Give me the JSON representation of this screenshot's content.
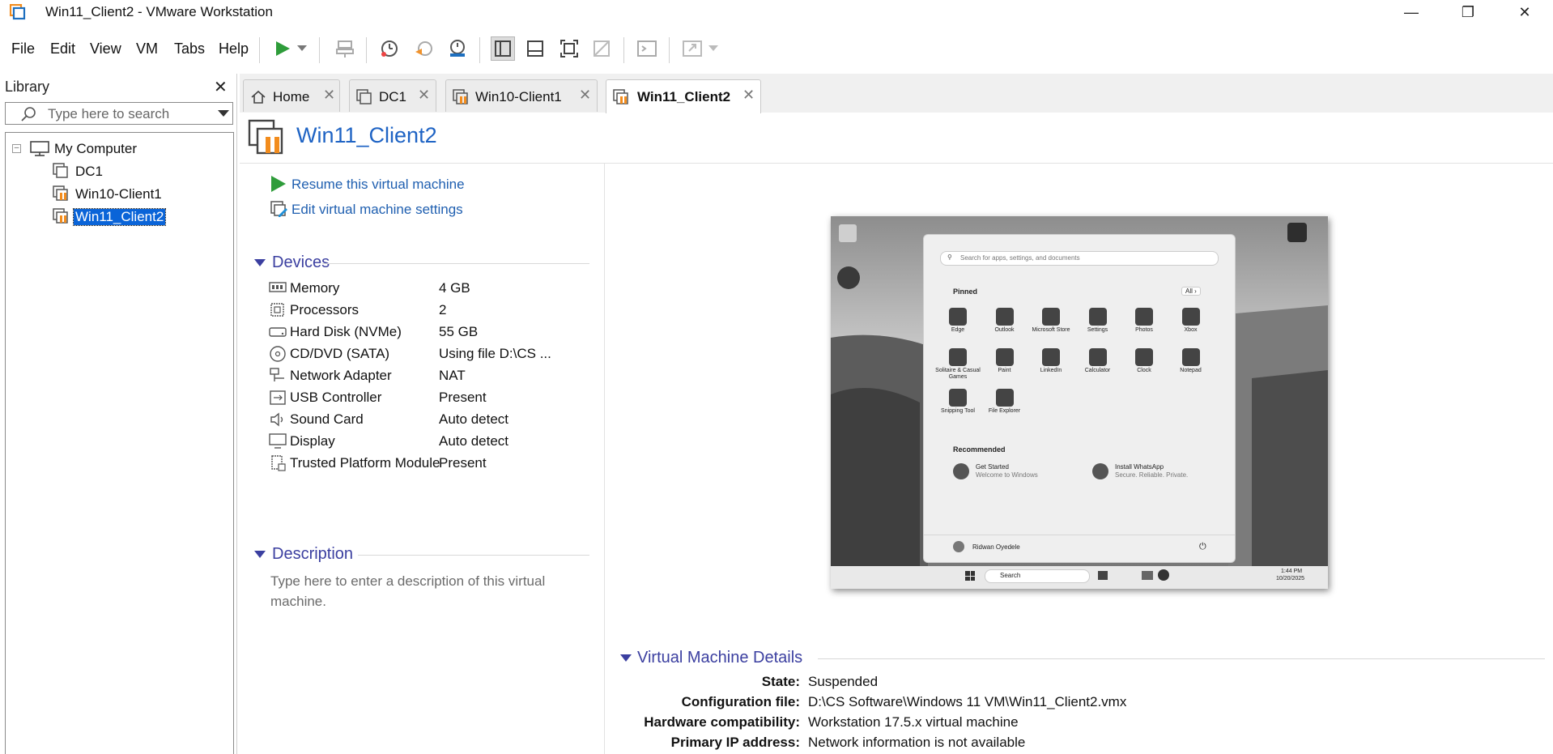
{
  "window": {
    "title": "Win11_Client2 - VMware Workstation",
    "minimize": "—",
    "maximize": "❐",
    "close": "✕"
  },
  "menu": [
    "File",
    "Edit",
    "View",
    "VM",
    "Tabs",
    "Help"
  ],
  "library": {
    "title": "Library",
    "close": "✕",
    "search_placeholder": "Type here to search",
    "tree": {
      "root": "My Computer",
      "items": [
        "DC1",
        "Win10-Client1",
        "Win11_Client2"
      ]
    }
  },
  "tabs": [
    {
      "label": "Home"
    },
    {
      "label": "DC1"
    },
    {
      "label": "Win10-Client1"
    },
    {
      "label": "Win11_Client2"
    }
  ],
  "vm": {
    "title": "Win11_Client2",
    "actions": {
      "resume": "Resume this virtual machine",
      "edit": "Edit virtual machine settings"
    },
    "devices_header": "Devices",
    "devices": [
      {
        "name": "Memory",
        "value": "4 GB",
        "icon": "memory-icon"
      },
      {
        "name": "Processors",
        "value": "2",
        "icon": "processor-icon"
      },
      {
        "name": "Hard Disk (NVMe)",
        "value": "55 GB",
        "icon": "harddisk-icon"
      },
      {
        "name": "CD/DVD (SATA)",
        "value": "Using file D:\\CS ...",
        "icon": "cd-icon"
      },
      {
        "name": "Network Adapter",
        "value": "NAT",
        "icon": "network-icon"
      },
      {
        "name": "USB Controller",
        "value": "Present",
        "icon": "usb-icon"
      },
      {
        "name": "Sound Card",
        "value": "Auto detect",
        "icon": "speaker-icon"
      },
      {
        "name": "Display",
        "value": "Auto detect",
        "icon": "display-icon"
      },
      {
        "name": "Trusted Platform Module",
        "value": "Present",
        "icon": "tpm-icon"
      }
    ],
    "description_header": "Description",
    "description_placeholder": "Type here to enter a description of this virtual machine.",
    "details_header": "Virtual Machine Details",
    "details": [
      {
        "key": "State:",
        "value": "Suspended"
      },
      {
        "key": "Configuration file:",
        "value": "D:\\CS Software\\Windows 11 VM\\Win11_Client2.vmx"
      },
      {
        "key": "Hardware compatibility:",
        "value": "Workstation 17.5.x virtual machine"
      },
      {
        "key": "Primary IP address:",
        "value": "Network information is not available"
      }
    ]
  },
  "guest_screen": {
    "search_placeholder": "Search for apps, settings, and documents",
    "pinned_label": "Pinned",
    "all_button": "All  ›",
    "pinned": [
      "Edge",
      "Outlook",
      "Microsoft Store",
      "Settings",
      "Photos",
      "Xbox",
      "Solitaire & Casual Games",
      "Paint",
      "LinkedIn",
      "Calculator",
      "Clock",
      "Notepad",
      "Snipping Tool",
      "File Explorer"
    ],
    "recommended_label": "Recommended",
    "recommended": [
      {
        "title": "Get Started",
        "sub": "Welcome to Windows"
      },
      {
        "title": "Install WhatsApp",
        "sub": "Secure. Reliable. Private."
      }
    ],
    "user": "Ridwan Oyedele",
    "taskbar_search": "Search",
    "time": "1:44 PM",
    "date": "10/20/2025"
  }
}
